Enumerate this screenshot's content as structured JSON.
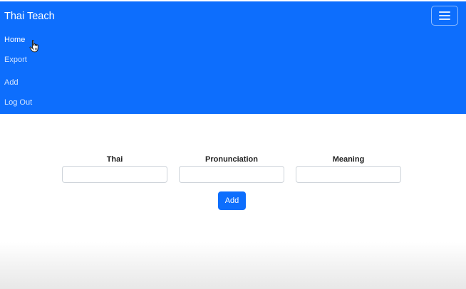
{
  "navbar": {
    "brand": "Thai Teach",
    "toggler_icon": "hamburger-menu-icon",
    "background_color": "#0d6efd",
    "links": [
      {
        "label": "Home",
        "active": true
      },
      {
        "label": "Export",
        "active": false
      },
      {
        "label": "Add",
        "active": false
      },
      {
        "label": "Log Out",
        "active": false
      }
    ]
  },
  "cursor_icon": "hand-pointer-icon",
  "form": {
    "fields": [
      {
        "label": "Thai",
        "value": "",
        "placeholder": ""
      },
      {
        "label": "Pronunciation",
        "value": "",
        "placeholder": ""
      },
      {
        "label": "Meaning",
        "value": "",
        "placeholder": ""
      }
    ],
    "submit_label": "Add",
    "submit_color": "#0d6efd"
  }
}
